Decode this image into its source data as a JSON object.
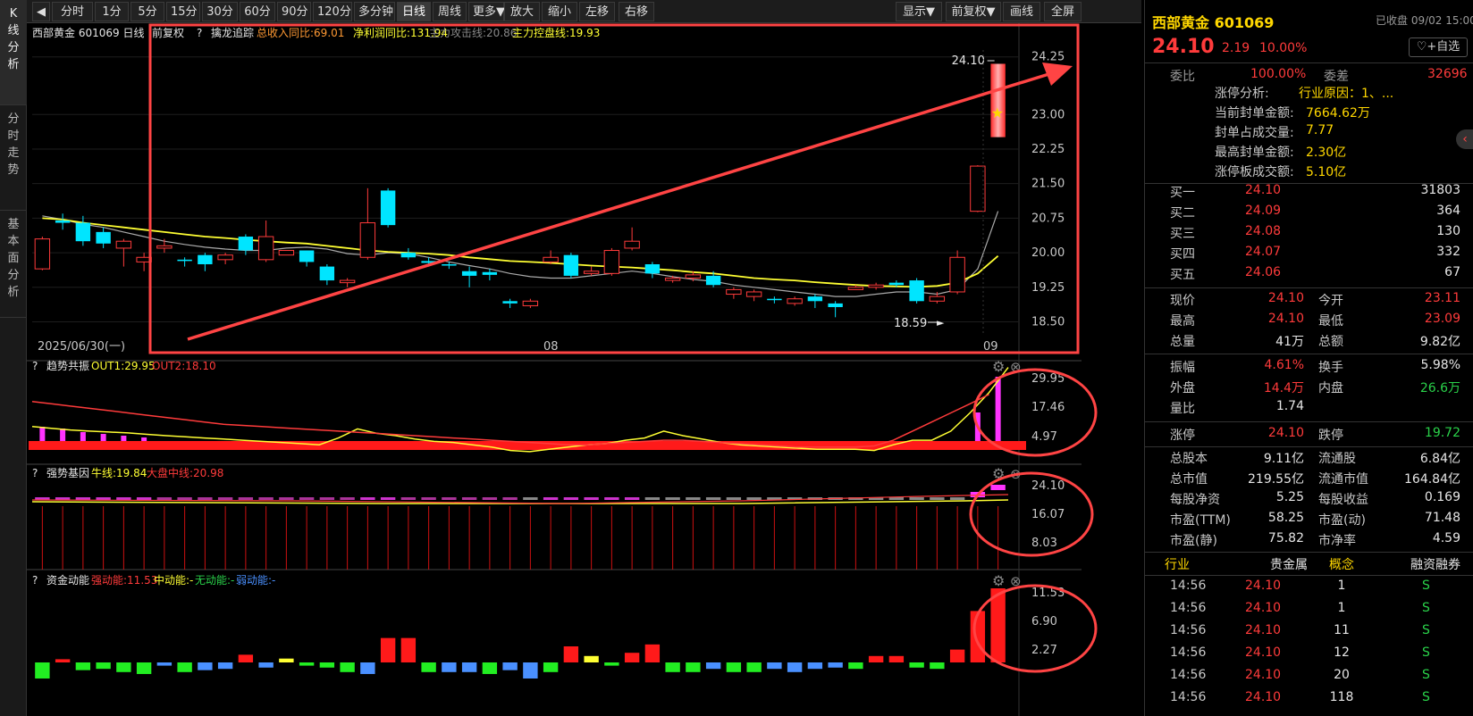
{
  "left_tabs": [
    {
      "label": "K线分析",
      "chars": [
        "K",
        "线",
        "分",
        "析"
      ]
    },
    {
      "label": "分时走势",
      "chars": [
        "分",
        "时",
        "走",
        "势"
      ]
    },
    {
      "label": "基本面分析",
      "chars": [
        "基",
        "本",
        "面",
        "分",
        "析"
      ]
    }
  ],
  "toolbar": {
    "back_icon": "◀",
    "periods": [
      "分时",
      "1分",
      "5分",
      "15分",
      "30分",
      "60分",
      "90分",
      "120分",
      "多分钟",
      "日线",
      "周线",
      "更多▼"
    ],
    "actions": [
      "放大",
      "缩小",
      "左移",
      "右移"
    ],
    "right": [
      "显示▼",
      "前复权▼",
      "画线",
      "全屏"
    ]
  },
  "main_chart": {
    "header_stock": "西部黄金 601069 日线",
    "header_adjust": "前复权",
    "header_q": "?",
    "indicator_name": "擒龙追踪",
    "revenue_label": "总收入同比:69.01",
    "profit_label": "净利润同比:131.94",
    "attack_label": "主力攻击线:20.86",
    "control_label": "主力控盘线:19.93",
    "high_marker": "24.10",
    "low_marker": "18.59",
    "date_start": "2025/06/30(一)",
    "month_labels": [
      "08",
      "09"
    ],
    "price_ticks": [
      "24.25",
      "23.00",
      "22.25",
      "21.50",
      "20.75",
      "20.00",
      "19.25",
      "18.50"
    ]
  },
  "chart_data": {
    "type": "candlestick",
    "candles": [
      {
        "o": 19.65,
        "c": 20.3,
        "h": 20.35,
        "l": 19.62
      },
      {
        "o": 20.7,
        "c": 20.65,
        "h": 20.85,
        "l": 20.5
      },
      {
        "o": 20.65,
        "c": 20.25,
        "h": 20.8,
        "l": 20.15
      },
      {
        "o": 20.45,
        "c": 20.2,
        "h": 20.55,
        "l": 20.1
      },
      {
        "o": 20.1,
        "c": 20.25,
        "h": 20.3,
        "l": 19.7
      },
      {
        "o": 19.8,
        "c": 19.9,
        "h": 20.0,
        "l": 19.6
      },
      {
        "o": 20.1,
        "c": 20.15,
        "h": 20.3,
        "l": 20.0
      },
      {
        "o": 19.85,
        "c": 19.82,
        "h": 19.9,
        "l": 19.7
      },
      {
        "o": 19.95,
        "c": 19.75,
        "h": 20.0,
        "l": 19.6
      },
      {
        "o": 19.85,
        "c": 19.95,
        "h": 20.0,
        "l": 19.75
      },
      {
        "o": 20.35,
        "c": 20.05,
        "h": 20.4,
        "l": 19.95
      },
      {
        "o": 19.85,
        "c": 20.35,
        "h": 20.7,
        "l": 19.8
      },
      {
        "o": 19.95,
        "c": 20.05,
        "h": 20.05,
        "l": 19.95
      },
      {
        "o": 20.05,
        "c": 19.8,
        "h": 20.05,
        "l": 19.7
      },
      {
        "o": 19.7,
        "c": 19.4,
        "h": 19.75,
        "l": 19.3
      },
      {
        "o": 19.35,
        "c": 19.4,
        "h": 19.45,
        "l": 19.25
      },
      {
        "o": 19.9,
        "c": 20.65,
        "h": 21.4,
        "l": 19.85
      },
      {
        "o": 21.35,
        "c": 20.6,
        "h": 21.4,
        "l": 20.55
      },
      {
        "o": 20.0,
        "c": 19.9,
        "h": 20.1,
        "l": 19.85
      },
      {
        "o": 19.82,
        "c": 19.78,
        "h": 19.9,
        "l": 19.7
      },
      {
        "o": 19.75,
        "c": 19.74,
        "h": 19.8,
        "l": 19.65
      },
      {
        "o": 19.6,
        "c": 19.5,
        "h": 19.7,
        "l": 19.25
      },
      {
        "o": 19.58,
        "c": 19.52,
        "h": 19.65,
        "l": 19.4
      },
      {
        "o": 18.95,
        "c": 18.9,
        "h": 19.0,
        "l": 18.8
      },
      {
        "o": 18.85,
        "c": 18.95,
        "h": 19.0,
        "l": 18.8
      },
      {
        "o": 19.8,
        "c": 19.9,
        "h": 20.05,
        "l": 19.75
      },
      {
        "o": 19.95,
        "c": 19.5,
        "h": 20.0,
        "l": 19.45
      },
      {
        "o": 19.55,
        "c": 19.6,
        "h": 19.7,
        "l": 19.5
      },
      {
        "o": 19.55,
        "c": 20.05,
        "h": 20.1,
        "l": 19.5
      },
      {
        "o": 20.1,
        "c": 20.25,
        "h": 20.55,
        "l": 20.05
      },
      {
        "o": 19.75,
        "c": 19.55,
        "h": 19.8,
        "l": 19.45
      },
      {
        "o": 19.4,
        "c": 19.45,
        "h": 19.5,
        "l": 19.35
      },
      {
        "o": 19.45,
        "c": 19.52,
        "h": 19.6,
        "l": 19.38
      },
      {
        "o": 19.5,
        "c": 19.3,
        "h": 19.6,
        "l": 19.25
      },
      {
        "o": 19.1,
        "c": 19.2,
        "h": 19.25,
        "l": 19.0
      },
      {
        "o": 19.05,
        "c": 19.15,
        "h": 19.2,
        "l": 18.95
      },
      {
        "o": 19.0,
        "c": 18.98,
        "h": 19.05,
        "l": 18.9
      },
      {
        "o": 18.9,
        "c": 19.0,
        "h": 19.05,
        "l": 18.85
      },
      {
        "o": 19.05,
        "c": 18.95,
        "h": 19.1,
        "l": 18.8
      },
      {
        "o": 18.9,
        "c": 18.82,
        "h": 18.95,
        "l": 18.6
      },
      {
        "o": 19.2,
        "c": 19.25,
        "h": 19.3,
        "l": 19.2
      },
      {
        "o": 19.25,
        "c": 19.3,
        "h": 19.35,
        "l": 19.2
      },
      {
        "o": 19.35,
        "c": 19.3,
        "h": 19.4,
        "l": 19.25
      },
      {
        "o": 19.4,
        "c": 18.95,
        "h": 19.45,
        "l": 18.9
      },
      {
        "o": 18.95,
        "c": 19.05,
        "h": 19.15,
        "l": 18.9
      },
      {
        "o": 19.15,
        "c": 19.9,
        "h": 20.05,
        "l": 19.1
      },
      {
        "o": 20.9,
        "c": 21.88,
        "h": 21.9,
        "l": 20.88
      },
      {
        "o": 23.11,
        "c": 24.1,
        "h": 24.1,
        "l": 23.09
      }
    ],
    "ma_white": [
      20.8,
      20.72,
      20.62,
      20.55,
      20.45,
      20.35,
      20.25,
      20.18,
      20.12,
      20.08,
      20.05,
      20.05,
      20.1,
      20.12,
      20.08,
      19.98,
      19.95,
      20.0,
      19.98,
      19.9,
      19.8,
      19.72,
      19.65,
      19.55,
      19.48,
      19.45,
      19.45,
      19.5,
      19.55,
      19.6,
      19.55,
      19.48,
      19.42,
      19.38,
      19.3,
      19.25,
      19.2,
      19.15,
      19.1,
      19.05,
      19.05,
      19.1,
      19.15,
      19.15,
      19.1,
      19.2,
      19.65,
      20.9
    ],
    "ma_yellow": [
      20.75,
      20.72,
      20.65,
      20.6,
      20.55,
      20.5,
      20.45,
      20.4,
      20.35,
      20.32,
      20.28,
      20.25,
      20.22,
      20.2,
      20.15,
      20.1,
      20.05,
      20.02,
      20.0,
      19.98,
      19.95,
      19.9,
      19.86,
      19.82,
      19.8,
      19.78,
      19.75,
      19.72,
      19.7,
      19.68,
      19.65,
      19.62,
      19.58,
      19.55,
      19.5,
      19.45,
      19.42,
      19.4,
      19.36,
      19.33,
      19.3,
      19.28,
      19.27,
      19.26,
      19.28,
      19.35,
      19.55,
      19.93
    ],
    "ylim": [
      18.2,
      24.4
    ]
  },
  "sub1": {
    "q": "?",
    "name": "趋势共振",
    "out1": "OUT1:29.95",
    "out2": "OUT2:18.10",
    "ticks": [
      "29.95",
      "17.46",
      "4.97"
    ],
    "bars": [
      8,
      7,
      5,
      4,
      3,
      2
    ],
    "yellow": [
      4,
      3.2,
      2.5,
      2,
      1.6,
      1.2,
      0.6,
      0,
      -0.5,
      -1,
      -1.5,
      -2,
      -2.5,
      -3,
      -3.5,
      -4,
      -1,
      3,
      1,
      0,
      -1.5,
      -2.5,
      -3,
      -4,
      -5,
      -6.5,
      -7,
      -6,
      -5,
      -4,
      -3.5,
      -2,
      -1,
      2,
      0,
      -1.5,
      -3,
      -4,
      -4.5,
      -5,
      -5.5,
      -6,
      -6,
      -6,
      -6.5,
      -4,
      -2,
      -2,
      2,
      10,
      19,
      29.95
    ],
    "red": [
      15,
      14,
      13,
      12,
      11,
      10,
      9,
      8,
      7,
      6,
      5,
      4.5,
      4,
      3.5,
      3,
      2.5,
      2,
      1.5,
      1,
      0.5,
      0,
      -0.5,
      -1,
      -1.5,
      -2,
      -2.5,
      -3,
      -3.5,
      -4,
      -4,
      -3.5,
      -3,
      -2.5,
      -2,
      -2,
      -2.5,
      -3,
      -3.5,
      -4,
      -4.5,
      -5,
      -5,
      -5,
      -5,
      -4.5,
      -2,
      2,
      6,
      10,
      14,
      18.1
    ]
  },
  "sub2": {
    "q": "?",
    "name": "强势基因",
    "bull": "牛线:19.84",
    "market": "大盘中线:20.98",
    "ticks": [
      "24.10",
      "16.07",
      "8.03"
    ]
  },
  "sub3": {
    "q": "?",
    "name": "资金动能",
    "strong": "强动能:11.53",
    "mid": "中动能:-",
    "none": "无动能:-",
    "weak": "弱动能:-",
    "ticks": [
      "11.53",
      "6.90",
      "2.27"
    ],
    "bars": [
      {
        "v": -2.5,
        "c": "g"
      },
      {
        "v": 0.5,
        "c": "r"
      },
      {
        "v": -1.2,
        "c": "g"
      },
      {
        "v": -1.0,
        "c": "g"
      },
      {
        "v": -1.5,
        "c": "g"
      },
      {
        "v": -1.8,
        "c": "g"
      },
      {
        "v": -0.5,
        "c": "b"
      },
      {
        "v": -1.5,
        "c": "g"
      },
      {
        "v": -1.2,
        "c": "b"
      },
      {
        "v": -1.0,
        "c": "b"
      },
      {
        "v": 1.2,
        "c": "r"
      },
      {
        "v": -0.8,
        "c": "b"
      },
      {
        "v": 0.6,
        "c": "y"
      },
      {
        "v": -0.5,
        "c": "g"
      },
      {
        "v": -0.8,
        "c": "g"
      },
      {
        "v": -1.5,
        "c": "g"
      },
      {
        "v": -1.8,
        "c": "b"
      },
      {
        "v": 3.8,
        "c": "r"
      },
      {
        "v": 3.8,
        "c": "r"
      },
      {
        "v": -1.5,
        "c": "g"
      },
      {
        "v": -1.5,
        "c": "b"
      },
      {
        "v": -1.5,
        "c": "b"
      },
      {
        "v": -1.8,
        "c": "g"
      },
      {
        "v": -1.2,
        "c": "b"
      },
      {
        "v": -2.5,
        "c": "b"
      },
      {
        "v": -1.5,
        "c": "g"
      },
      {
        "v": 2.5,
        "c": "r"
      },
      {
        "v": 1.0,
        "c": "y"
      },
      {
        "v": -0.5,
        "c": "g"
      },
      {
        "v": 1.5,
        "c": "r"
      },
      {
        "v": 2.8,
        "c": "r"
      },
      {
        "v": -1.5,
        "c": "g"
      },
      {
        "v": -1.5,
        "c": "g"
      },
      {
        "v": -1.0,
        "c": "b"
      },
      {
        "v": -1.5,
        "c": "g"
      },
      {
        "v": -1.5,
        "c": "g"
      },
      {
        "v": -1.0,
        "c": "b"
      },
      {
        "v": -1.5,
        "c": "b"
      },
      {
        "v": -1.0,
        "c": "b"
      },
      {
        "v": -0.8,
        "c": "b"
      },
      {
        "v": -1.0,
        "c": "g"
      },
      {
        "v": 1.0,
        "c": "r"
      },
      {
        "v": 1.0,
        "c": "r"
      },
      {
        "v": -0.8,
        "c": "g"
      },
      {
        "v": -1.0,
        "c": "g"
      },
      {
        "v": 2.0,
        "c": "r"
      },
      {
        "v": 8.0,
        "c": "r"
      },
      {
        "v": 11.53,
        "c": "r"
      }
    ]
  },
  "quote": {
    "name": "西部黄金 601069",
    "status": "已收盘 09/02 15:00",
    "price": "24.10",
    "change": "2.19",
    "pct": "10.00%",
    "fav": "+自选",
    "collapse": "‹",
    "weibi_label": "委比",
    "weibi": "100.00%",
    "weicha_label": "委差",
    "weicha": "32696",
    "limit_info": [
      {
        "k": "涨停分析:",
        "v": "行业原因：1、..."
      },
      {
        "k": "当前封单金额:",
        "v": "7664.62万"
      },
      {
        "k": "封单占成交量:",
        "v": "7.77"
      },
      {
        "k": "最高封单金额:",
        "v": "2.30亿"
      },
      {
        "k": "涨停板成交额:",
        "v": "5.10亿"
      }
    ],
    "bids": [
      {
        "k": "买一",
        "p": "24.10",
        "v": "31803"
      },
      {
        "k": "买二",
        "p": "24.09",
        "v": "364"
      },
      {
        "k": "买三",
        "p": "24.08",
        "v": "130"
      },
      {
        "k": "买四",
        "p": "24.07",
        "v": "332"
      },
      {
        "k": "买五",
        "p": "24.06",
        "v": "67"
      }
    ],
    "stats1": [
      {
        "k1": "现价",
        "v1": "24.10",
        "k2": "今开",
        "v2": "23.11",
        "c1": "red",
        "c2": "red"
      },
      {
        "k1": "最高",
        "v1": "24.10",
        "k2": "最低",
        "v2": "23.09",
        "c1": "red",
        "c2": "red"
      },
      {
        "k1": "总量",
        "v1": "41万",
        "k2": "总额",
        "v2": "9.82亿",
        "c1": "white",
        "c2": "white"
      }
    ],
    "stats2": [
      {
        "k1": "振幅",
        "v1": "4.61%",
        "k2": "换手",
        "v2": "5.98%",
        "c1": "red",
        "c2": "white"
      },
      {
        "k1": "外盘",
        "v1": "14.4万",
        "k2": "内盘",
        "v2": "26.6万",
        "c1": "red",
        "c2": "green"
      },
      {
        "k1": "量比",
        "v1": "1.74",
        "k2": "",
        "v2": "",
        "c1": "white",
        "c2": "white"
      }
    ],
    "limit": {
      "k1": "涨停",
      "v1": "24.10",
      "k2": "跌停",
      "v2": "19.72"
    },
    "stats3": [
      {
        "k1": "总股本",
        "v1": "9.11亿",
        "k2": "流通股",
        "v2": "6.84亿"
      },
      {
        "k1": "总市值",
        "v1": "219.55亿",
        "k2": "流通市值",
        "v2": "164.84亿"
      },
      {
        "k1": "每股净资",
        "v1": "5.25",
        "k2": "每股收益",
        "v2": "0.169"
      },
      {
        "k1": "市盈(TTM)",
        "v1": "58.25",
        "k2": "市盈(动)",
        "v2": "71.48"
      },
      {
        "k1": "市盈(静)",
        "v1": "75.82",
        "k2": "市净率",
        "v2": "4.59"
      }
    ],
    "industry": {
      "k": "行业",
      "v": "贵金属",
      "k2": "概念",
      "v2": "融资融券"
    },
    "ticks": [
      {
        "t": "14:56",
        "p": "24.10",
        "v": "1",
        "s": "S"
      },
      {
        "t": "14:56",
        "p": "24.10",
        "v": "1",
        "s": "S"
      },
      {
        "t": "14:56",
        "p": "24.10",
        "v": "11",
        "s": "S"
      },
      {
        "t": "14:56",
        "p": "24.10",
        "v": "12",
        "s": "S"
      },
      {
        "t": "14:56",
        "p": "24.10",
        "v": "20",
        "s": "S"
      },
      {
        "t": "14:56",
        "p": "24.10",
        "v": "118",
        "s": "S"
      }
    ]
  },
  "colors": {
    "up": "#ff3b3b",
    "down": "#00e5ff",
    "yellow": "#ffff33",
    "frame": "#ff4444"
  }
}
